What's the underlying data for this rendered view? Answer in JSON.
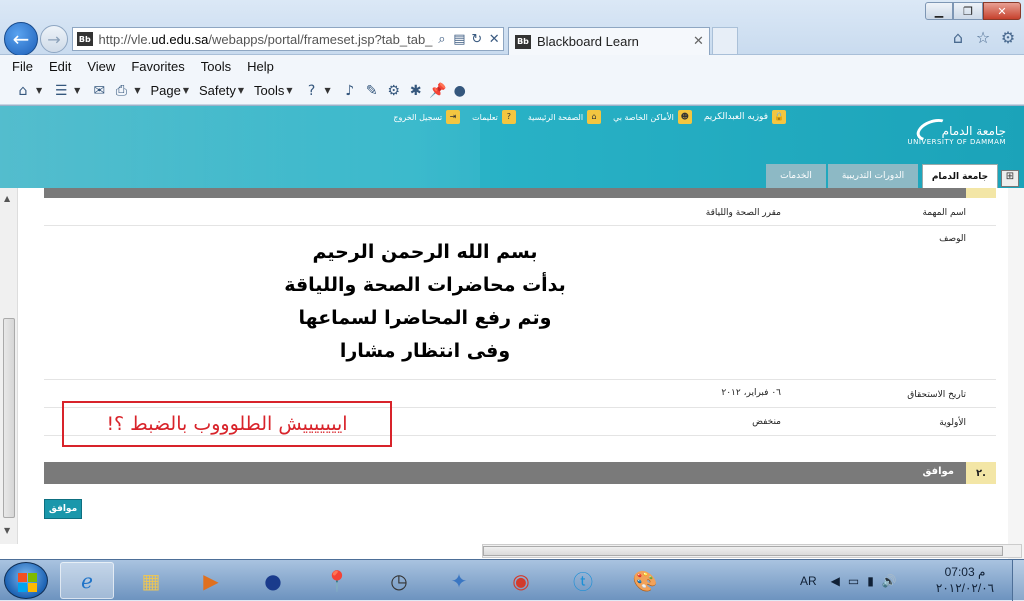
{
  "browser": {
    "url_prefix": "http://vle.",
    "url_domain": "ud.edu.sa",
    "url_rest": "/webapps/portal/frameset.jsp?tab_tab_gr",
    "tab_title": "Blackboard Learn",
    "tab_favicon": "Bb",
    "menu": [
      "File",
      "Edit",
      "View",
      "Favorites",
      "Tools",
      "Help"
    ],
    "commands": {
      "page": "Page",
      "safety": "Safety",
      "tools": "Tools"
    }
  },
  "header": {
    "user_name": "فوزيه العبدالكريم",
    "links": [
      "الأماكن الخاصة بي",
      "الصفحة الرئيسية",
      "تعليمات",
      "تسجيل الخروج"
    ],
    "logo_ar": "جامعة الدمام",
    "logo_en": "UNIVERSITY OF DAMMAM"
  },
  "tabs": {
    "university": "جامعة الدمام",
    "courses": "الدورات التدريبية",
    "services": "الخدمات"
  },
  "task": {
    "name_label": "اسم المهمة",
    "name_value": "مقرر الصحة واللياقة",
    "desc_label": "الوصف",
    "desc_lines": [
      "بسم الله الرحمن الرحيم",
      "بدأت محاضرات الصحة واللياقة",
      "وتم رفع المحاضرا لسماعها",
      "وفى انتظار مشارا"
    ],
    "due_label": "تاريخ الاستحقاق",
    "due_value": "٠٦ فبراير، ٢٠١٢",
    "priority_label": "الأولوية",
    "priority_value": "منخفض"
  },
  "annotation": "ايييييييش الطلوووب بالضبط ؟!",
  "section2": {
    "number": "٢.",
    "title": "موافق"
  },
  "ok_button": "موافق",
  "taskbar": {
    "language": "AR",
    "time": "07:03 م",
    "date": "٢٠١٢/٠٢/٠٦"
  },
  "colors": {
    "header_teal": "#1aa7bd",
    "annotation_red": "#d8232a",
    "button_teal": "#1a97ab"
  }
}
